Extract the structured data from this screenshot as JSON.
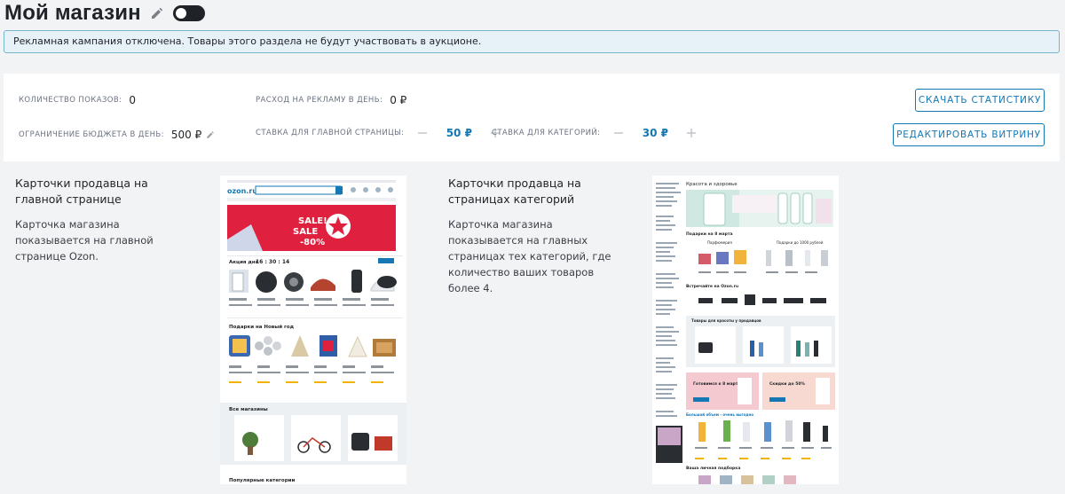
{
  "header": {
    "title": "Мой магазин",
    "edit_icon": "pencil-icon",
    "toggle_state": "off"
  },
  "alert": {
    "text": "Рекламная кампания отключена. Товары этого раздела не будут участвовать в аукционе."
  },
  "stats": {
    "impressions_label": "Количество показов:",
    "impressions_value": "0",
    "ad_spend_label": "Расход на рекламу в день:",
    "ad_spend_value": "0 ₽",
    "budget_label": "Ограничение бюджета в день:",
    "budget_value": "500 ₽",
    "main_bid_label": "Ставка для главной страницы:",
    "main_bid_value": "50 ₽",
    "category_bid_label": "Ставка для категорий:",
    "category_bid_value": "30 ₽",
    "download_button": "Скачать статистику",
    "edit_showcase_button": "Редактировать витрину"
  },
  "cards": [
    {
      "heading": "Карточки продавца на главной странице",
      "description": "Карточка магазина показывается на главной странице Ozon."
    },
    {
      "heading": "Карточки продавца на страницах категорий",
      "description": "Карточка магазина показывается на главных страницах тех категорий, где количество ваших товаров более 4."
    }
  ],
  "previews": {
    "main_page": {
      "logo": "ozon.ru",
      "banner_line1": "SALE!",
      "banner_line2": "SALE",
      "banner_line3": "-80%",
      "action_label": "Акция дня",
      "timer": "16 : 30 : 14",
      "section_gifts": "Подарки на Новый год",
      "section_stores": "Все магазины",
      "section_categories": "Популярные категории"
    },
    "category_page": {
      "breadcrumb": "Красота и здоровье",
      "gifts_march": "Подарки на 8 марта",
      "perfumery": "Парфюмерия",
      "gifts_under": "Подарки до 1000 рублей",
      "brands_title": "Встречайте на Ozon.ru",
      "seller_title": "Товары для красоты у продавцов",
      "promo_left": "Готовимся к 8 марта",
      "promo_right": "Скидки до 50%",
      "big_volume": "Большой объем - очень выгодно",
      "personal": "Ваша личная подборка"
    }
  },
  "colors": {
    "accent": "#1577b3",
    "alert_bg": "#e6f2f8",
    "alert_border": "#7ab4cc",
    "banner_red": "#e0203f"
  }
}
